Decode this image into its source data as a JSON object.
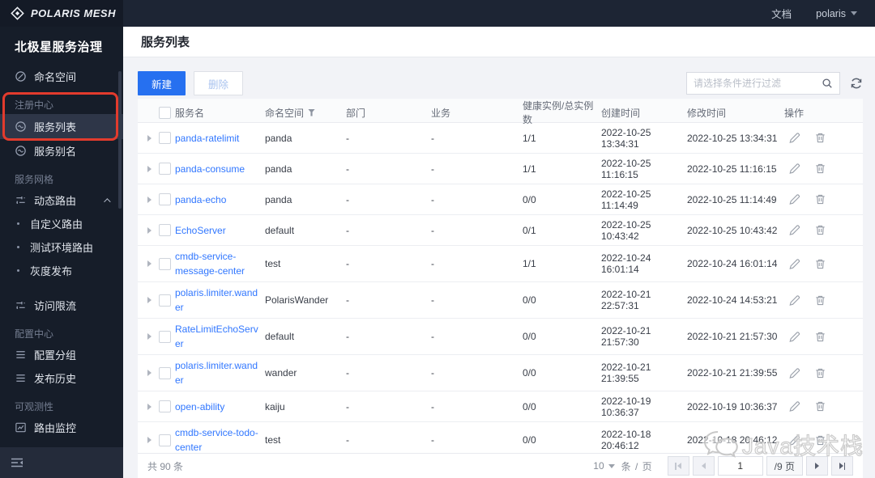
{
  "topbar": {
    "logo_text": "POLARIS MESH",
    "doc_link": "文档",
    "user_menu": "polaris"
  },
  "sidebar": {
    "title": "北极星服务治理",
    "items": [
      {
        "type": "item",
        "icon": "circle-slash-icon",
        "label": "命名空间"
      },
      {
        "type": "section",
        "label": "注册中心"
      },
      {
        "type": "item",
        "icon": "service-icon",
        "label": "服务列表",
        "selected": true
      },
      {
        "type": "item",
        "icon": "service-icon",
        "label": "服务别名"
      },
      {
        "type": "section",
        "label": "服务网格"
      },
      {
        "type": "item",
        "icon": "sliders-icon",
        "label": "动态路由",
        "caret": "up"
      },
      {
        "type": "subitem",
        "label": "自定义路由"
      },
      {
        "type": "subitem",
        "label": "测试环境路由"
      },
      {
        "type": "subitem",
        "label": "灰度发布"
      },
      {
        "type": "item",
        "icon": "sliders-icon",
        "label": "访问限流"
      },
      {
        "type": "section",
        "label": "配置中心"
      },
      {
        "type": "item",
        "icon": "menu-lines-icon",
        "label": "配置分组"
      },
      {
        "type": "item",
        "icon": "menu-lines-icon",
        "label": "发布历史"
      },
      {
        "type": "section",
        "label": "可观测性"
      },
      {
        "type": "item",
        "icon": "monitor-chart-icon",
        "label": "路由监控"
      },
      {
        "type": "item",
        "icon": "menu-lines-icon",
        "label": "",
        "clipped": true
      }
    ]
  },
  "page": {
    "title": "服务列表"
  },
  "toolbar": {
    "create_label": "新建",
    "delete_label": "删除",
    "search_placeholder": "请选择条件进行过滤"
  },
  "table": {
    "columns": [
      "服务名",
      "命名空间",
      "部门",
      "业务",
      "健康实例/总实例数",
      "创建时间",
      "修改时间",
      "操作"
    ],
    "rows": [
      {
        "name": "panda-ratelimit",
        "namespace": "panda",
        "dept": "-",
        "biz": "-",
        "health": "1/1",
        "created": "2022-10-25 13:34:31",
        "modified": "2022-10-25 13:34:31"
      },
      {
        "name": "panda-consume",
        "namespace": "panda",
        "dept": "-",
        "biz": "-",
        "health": "1/1",
        "created": "2022-10-25 11:16:15",
        "modified": "2022-10-25 11:16:15"
      },
      {
        "name": "panda-echo",
        "namespace": "panda",
        "dept": "-",
        "biz": "-",
        "health": "0/0",
        "created": "2022-10-25 11:14:49",
        "modified": "2022-10-25 11:14:49"
      },
      {
        "name": "EchoServer",
        "namespace": "default",
        "dept": "-",
        "biz": "-",
        "health": "0/1",
        "created": "2022-10-25 10:43:42",
        "modified": "2022-10-25 10:43:42"
      },
      {
        "name": "cmdb-service-message-center",
        "namespace": "test",
        "dept": "-",
        "biz": "-",
        "health": "1/1",
        "created": "2022-10-24 16:01:14",
        "modified": "2022-10-24 16:01:14"
      },
      {
        "name": "polaris.limiter.wander",
        "namespace": "PolarisWander",
        "dept": "-",
        "biz": "-",
        "health": "0/0",
        "created": "2022-10-21 22:57:31",
        "modified": "2022-10-24 14:53:21"
      },
      {
        "name": "RateLimitEchoServer",
        "namespace": "default",
        "dept": "-",
        "biz": "-",
        "health": "0/0",
        "created": "2022-10-21 21:57:30",
        "modified": "2022-10-21 21:57:30"
      },
      {
        "name": "polaris.limiter.wander",
        "namespace": "wander",
        "dept": "-",
        "biz": "-",
        "health": "0/0",
        "created": "2022-10-21 21:39:55",
        "modified": "2022-10-21 21:39:55"
      },
      {
        "name": "open-ability",
        "namespace": "kaiju",
        "dept": "-",
        "biz": "-",
        "health": "0/0",
        "created": "2022-10-19 10:36:37",
        "modified": "2022-10-19 10:36:37"
      },
      {
        "name": "cmdb-service-todo-center",
        "namespace": "test",
        "dept": "-",
        "biz": "-",
        "health": "0/0",
        "created": "2022-10-18 20:46:12",
        "modified": "2022-10-18 20:46:12"
      }
    ]
  },
  "footer": {
    "total_text": "共 90 条",
    "page_size": "10",
    "per_page_label": "条 / 页",
    "current_page": "1",
    "total_pages_label": "/9 页"
  },
  "watermark": {
    "text": "Java技术栈"
  },
  "colors": {
    "primary": "#2670f0",
    "link": "#3177ff",
    "annotation": "#e23b2d"
  }
}
